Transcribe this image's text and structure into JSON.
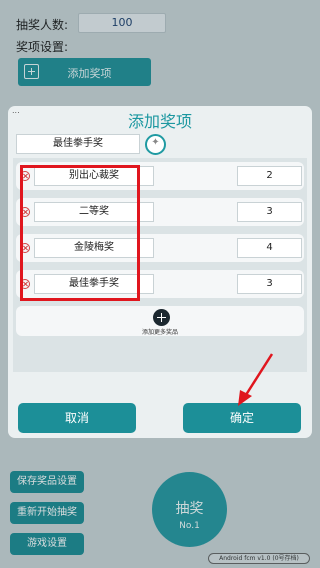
{
  "page": {
    "count_label": "抽奖人数:",
    "count_value": "100",
    "prize_setting_label": "奖项设置:",
    "add_prize_label": "添加奖项"
  },
  "side_buttons": [
    {
      "label": "保存奖品设置"
    },
    {
      "label": "重新开始抽奖"
    },
    {
      "label": "游戏设置"
    }
  ],
  "draw_button": {
    "label": "抽奖",
    "sub": "No.1"
  },
  "version": "Android fcm v1.0 (0号存档)",
  "dialog": {
    "dots": "...",
    "title": "添加奖项",
    "new_prize_name": "最佳拳手奖",
    "prizes": [
      {
        "name": "别出心裁奖",
        "qty": "2"
      },
      {
        "name": "二等奖",
        "qty": "3"
      },
      {
        "name": "金陵梅奖",
        "qty": "4"
      },
      {
        "name": "最佳拳手奖",
        "qty": "3"
      }
    ],
    "add_more_label": "添加更多奖品",
    "cancel_label": "取消",
    "confirm_label": "确定"
  },
  "colors": {
    "accent": "#1c8f98",
    "title": "#1b97a0",
    "annotation": "#e0161e"
  },
  "icons": [
    "plus-box-icon",
    "random-icon",
    "delete-icon",
    "add-circle-icon",
    "arrow-annotation"
  ]
}
